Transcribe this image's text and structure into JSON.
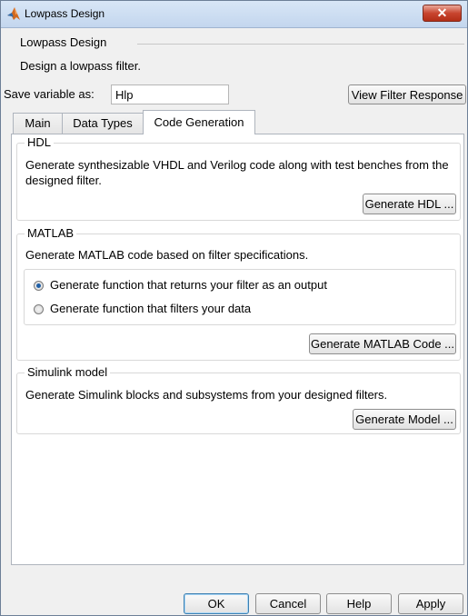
{
  "window": {
    "title": "Lowpass Design",
    "close_label": "✕"
  },
  "header": {
    "title": "Lowpass Design",
    "description": "Design a lowpass filter."
  },
  "save": {
    "label": "Save variable as:",
    "value": "Hlp",
    "view_button": "View Filter Response"
  },
  "tabs": [
    {
      "label": "Main"
    },
    {
      "label": "Data Types"
    },
    {
      "label": "Code Generation"
    }
  ],
  "active_tab": "Code Generation",
  "hdl": {
    "title": "HDL",
    "description": "Generate synthesizable VHDL and Verilog code along with test benches from the designed filter.",
    "button": "Generate HDL ..."
  },
  "matlab": {
    "title": "MATLAB",
    "description": "Generate MATLAB code based on filter specifications.",
    "options": [
      {
        "label": "Generate function that returns your filter as an output",
        "checked": true
      },
      {
        "label": "Generate function that filters your data",
        "checked": false
      }
    ],
    "button": "Generate MATLAB Code ..."
  },
  "simulink": {
    "title": "Simulink model",
    "description": "Generate Simulink blocks and subsystems from your designed filters.",
    "button": "Generate Model ..."
  },
  "footer": {
    "ok": "OK",
    "cancel": "Cancel",
    "help": "Help",
    "apply": "Apply"
  }
}
